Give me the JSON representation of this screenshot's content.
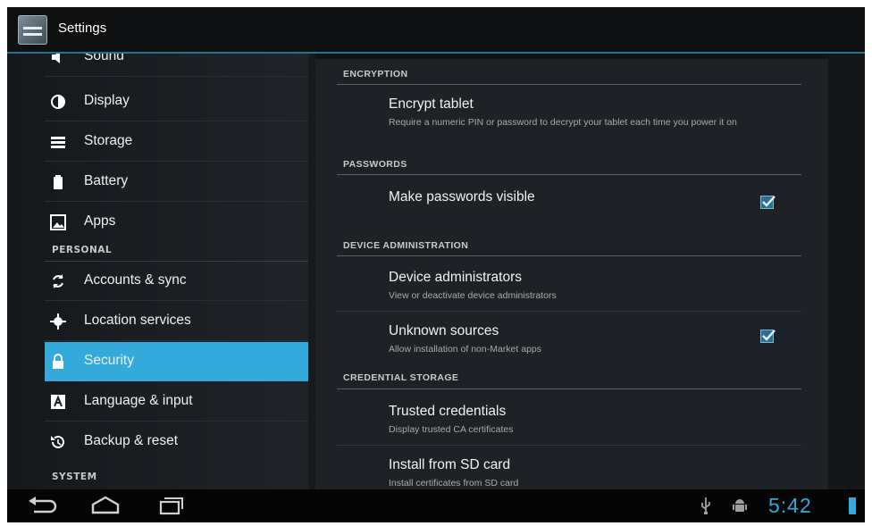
{
  "app": {
    "title": "Settings",
    "icon": "settings-app-icon"
  },
  "sidebar": {
    "items": [
      {
        "label": "Sound",
        "icon": "speaker-icon"
      },
      {
        "label": "Display",
        "icon": "brightness-icon"
      },
      {
        "label": "Storage",
        "icon": "storage-icon"
      },
      {
        "label": "Battery",
        "icon": "battery-icon"
      },
      {
        "label": "Apps",
        "icon": "apps-icon"
      },
      {
        "label": "Accounts & sync",
        "icon": "sync-icon"
      },
      {
        "label": "Location services",
        "icon": "location-icon"
      },
      {
        "label": "Security",
        "icon": "lock-icon",
        "selected": true
      },
      {
        "label": "Language & input",
        "icon": "language-icon"
      },
      {
        "label": "Backup & reset",
        "icon": "backup-icon"
      }
    ],
    "headers": {
      "personal": "PERSONAL",
      "system": "SYSTEM"
    }
  },
  "content": {
    "encryption": {
      "header": "ENCRYPTION",
      "encrypt_title": "Encrypt tablet",
      "encrypt_sub": "Require a numeric PIN or password to decrypt your tablet each time you power it on"
    },
    "passwords": {
      "header": "PASSWORDS",
      "visible_title": "Make passwords visible",
      "visible_checked": true
    },
    "device_admin": {
      "header": "DEVICE ADMINISTRATION",
      "admins_title": "Device administrators",
      "admins_sub": "View or deactivate device administrators",
      "unknown_title": "Unknown sources",
      "unknown_sub": "Allow installation of non-Market apps",
      "unknown_checked": true
    },
    "credential": {
      "header": "CREDENTIAL STORAGE",
      "trusted_title": "Trusted credentials",
      "trusted_sub": "Display trusted CA certificates",
      "install_title": "Install from SD card",
      "install_sub": "Install certificates from SD card"
    }
  },
  "system_bar": {
    "time": "5:42",
    "accent": "#33a9dc"
  }
}
